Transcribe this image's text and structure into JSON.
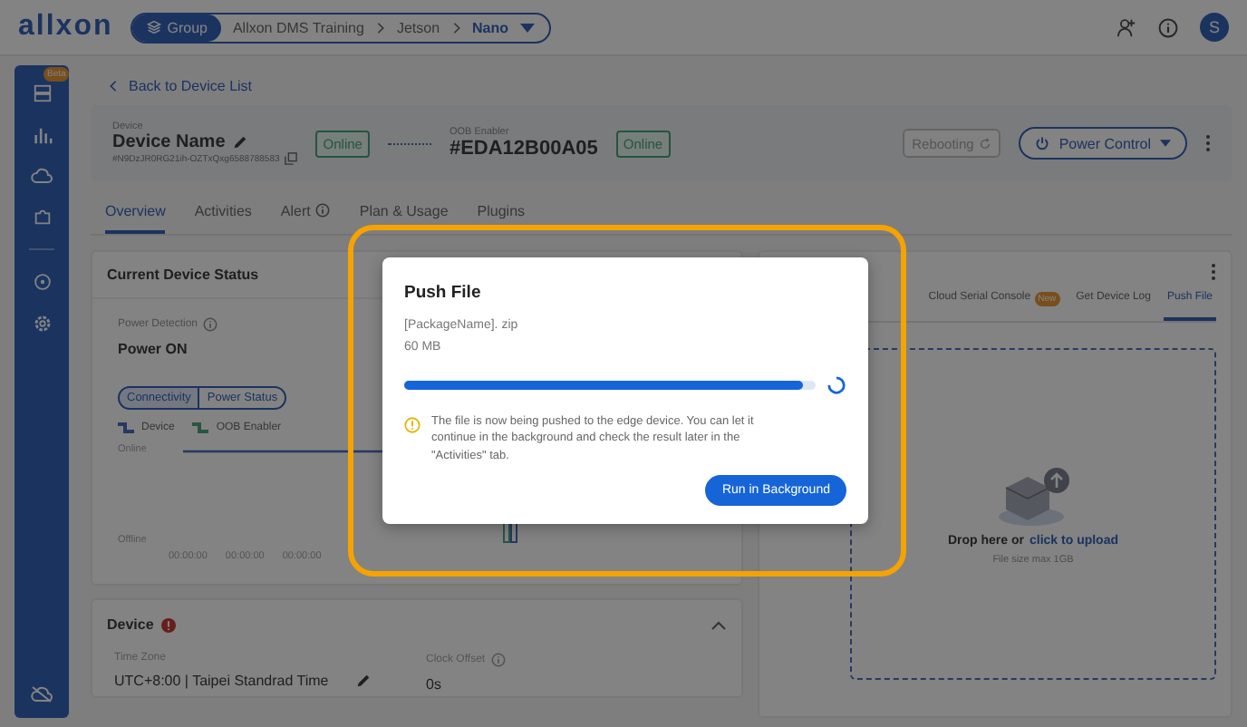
{
  "header": {
    "logo": "allxon",
    "group_button": "Group",
    "breadcrumbs": [
      {
        "label": "Allxon DMS Training",
        "selected": false
      },
      {
        "label": "Jetson",
        "selected": false
      },
      {
        "label": "Nano",
        "selected": true
      }
    ],
    "avatar": "S"
  },
  "sidebar": {
    "badge": "Beta"
  },
  "back_link": "Back to Device List",
  "device_card": {
    "device_label": "Device",
    "device_name": "Device Name",
    "device_id": "#N9DzJR0RG21ih-OZTxQxg6588788583",
    "device_status": "Online",
    "oob_label": "OOB Enabler",
    "oob_name": "#EDA12B00A05",
    "oob_status": "Online",
    "reboot_button": {
      "label": "Rebooting",
      "disabled": true
    },
    "power_button": "Power Control"
  },
  "tabs": [
    {
      "label": "Overview",
      "selected": true,
      "kind": "plain"
    },
    {
      "label": "Activities",
      "selected": false,
      "kind": "plain"
    },
    {
      "label": "Alert",
      "selected": false,
      "kind": "info"
    },
    {
      "label": "Plan & Usage",
      "selected": false,
      "kind": "plain"
    },
    {
      "label": "Plugins",
      "selected": false,
      "kind": "plain"
    }
  ],
  "status_card": {
    "title": "Current Device Status",
    "power_label": "Power Detection",
    "power_value": "Power ON",
    "toggle": [
      {
        "label": "Connectivity",
        "selected": true
      },
      {
        "label": "Power Status",
        "selected": false
      }
    ],
    "legend": [
      {
        "label": "Device",
        "color": "#263b61"
      },
      {
        "label": "OOB Enabler",
        "color": "#2b5644"
      }
    ],
    "y_labels": [
      "Online",
      "Offline"
    ],
    "x_labels": [
      "00:00:00",
      "00:00:00",
      "00:00:00"
    ]
  },
  "device_section": {
    "title": "Device",
    "alert": true,
    "expanded": true,
    "fields": [
      {
        "label": "Time Zone",
        "value": "UTC+8:00 | Taipei Standrad Time",
        "kind": "editable"
      },
      {
        "label": "Clock Offset",
        "value": "0s",
        "kind": "info"
      }
    ]
  },
  "file_panel": {
    "tabs": [
      {
        "label": "Cloud Serial Console",
        "badge": "New",
        "selected": false
      },
      {
        "label": "Get Device Log",
        "selected": false
      },
      {
        "label": "Push File",
        "selected": true
      }
    ],
    "drop_prompt": "Drop here or",
    "upload_link": "click to upload",
    "size_note": "File size max 1GB"
  },
  "dialog": {
    "title": "Push File",
    "file_name": "[PackageName]. zip",
    "file_size": "60 MB",
    "progress": {
      "level": 0.97
    },
    "message": "The file is now being pushed to the edge device. You can let it continue in the background and check the result later in the \"Activities\" tab.",
    "button": "Run in Background"
  }
}
